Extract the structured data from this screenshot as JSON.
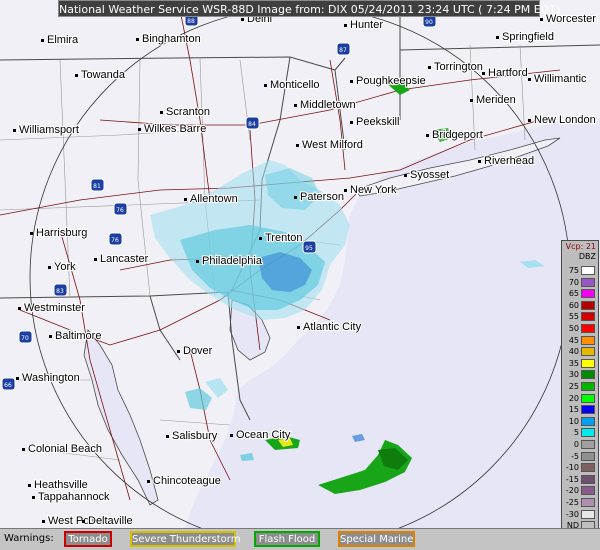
{
  "header": {
    "title": "National Weather Service WSR-88D Image from: DIX 05/24/2011 23:24 UTC ( 7:24 PM EDT)"
  },
  "map": {
    "cities": [
      {
        "name": "Elmira"
      },
      {
        "name": "Binghamton"
      },
      {
        "name": "Delhi"
      },
      {
        "name": "Hunter"
      },
      {
        "name": "Worcester"
      },
      {
        "name": "Springfield"
      },
      {
        "name": "Towanda"
      },
      {
        "name": "Monticello"
      },
      {
        "name": "Poughkeepsie"
      },
      {
        "name": "Torrington"
      },
      {
        "name": "Hartford"
      },
      {
        "name": "Willimantic"
      },
      {
        "name": "Middletown"
      },
      {
        "name": "Meriden"
      },
      {
        "name": "New London"
      },
      {
        "name": "Scranton"
      },
      {
        "name": "Wilkes Barre"
      },
      {
        "name": "Williamsport"
      },
      {
        "name": "Peekskill"
      },
      {
        "name": "Bridgeport"
      },
      {
        "name": "Riverhead"
      },
      {
        "name": "West Milford"
      },
      {
        "name": "Syosset"
      },
      {
        "name": "Paterson"
      },
      {
        "name": "New York"
      },
      {
        "name": "Allentown"
      },
      {
        "name": "Harrisburg"
      },
      {
        "name": "Trenton"
      },
      {
        "name": "Lancaster"
      },
      {
        "name": "York"
      },
      {
        "name": "Philadelphia"
      },
      {
        "name": "Westminster"
      },
      {
        "name": "Atlantic City"
      },
      {
        "name": "Baltimore"
      },
      {
        "name": "Dover"
      },
      {
        "name": "Washington"
      },
      {
        "name": "Salisbury"
      },
      {
        "name": "Ocean City"
      },
      {
        "name": "Colonial Beach"
      },
      {
        "name": "Chincoteague"
      },
      {
        "name": "Heathsville"
      },
      {
        "name": "Tappahannock"
      },
      {
        "name": "West Point"
      },
      {
        "name": "Deltaville"
      }
    ],
    "highway_shields": [
      {
        "num": "88"
      },
      {
        "num": "90"
      },
      {
        "name": "87"
      },
      {
        "num": "84"
      },
      {
        "num": "81"
      },
      {
        "num": "76"
      },
      {
        "num": "76"
      },
      {
        "num": "95"
      },
      {
        "num": "83"
      },
      {
        "num": "70"
      },
      {
        "num": "66"
      }
    ],
    "colors": {
      "land": "#f0f0f6",
      "ocean": "#e6e6f6",
      "radar_light": "#9de0ef",
      "radar_mid": "#63cbe0",
      "radar_blue": "#2f7fd4",
      "radar_green": "#18a518",
      "radar_yellow": "#e8e817",
      "state_line": "#4a4a4a",
      "county_line": "#8c8c8c",
      "road": "#7a1010"
    }
  },
  "legend": {
    "vcp": "Vcp: 21",
    "unit": "DBZ",
    "levels": [
      {
        "label": "75",
        "color": "#ffffff"
      },
      {
        "label": "70",
        "color": "#9a57c4"
      },
      {
        "label": "65",
        "color": "#f200f2"
      },
      {
        "label": "60",
        "color": "#b50000"
      },
      {
        "label": "55",
        "color": "#d60000"
      },
      {
        "label": "50",
        "color": "#ff0000"
      },
      {
        "label": "45",
        "color": "#ff9000"
      },
      {
        "label": "40",
        "color": "#e6b800"
      },
      {
        "label": "35",
        "color": "#ffff00"
      },
      {
        "label": "30",
        "color": "#008c00"
      },
      {
        "label": "25",
        "color": "#00b400"
      },
      {
        "label": "20",
        "color": "#00ff00"
      },
      {
        "label": "15",
        "color": "#0000f0"
      },
      {
        "label": "10",
        "color": "#00a0f0"
      },
      {
        "label": "5",
        "color": "#00ecec"
      },
      {
        "label": "0",
        "color": "#a0a0a0"
      },
      {
        "label": "-5",
        "color": "#909090"
      },
      {
        "label": "-10",
        "color": "#806060"
      },
      {
        "label": "-15",
        "color": "#705070"
      },
      {
        "label": "-20",
        "color": "#8a5a8a"
      },
      {
        "label": "-25",
        "color": "#b090b0"
      },
      {
        "label": "-30",
        "color": "#e8e8e8"
      },
      {
        "label": "ND",
        "color": "#c0c0c0"
      }
    ]
  },
  "warnings": {
    "label": "Warnings:",
    "items": [
      {
        "label": "Tornado",
        "border": "#cc0000"
      },
      {
        "label": "Severe Thunderstorm",
        "border": "#d4c000"
      },
      {
        "label": "Flash Flood",
        "border": "#00aa00"
      },
      {
        "label": "Special Marine",
        "border": "#e08000"
      }
    ]
  }
}
